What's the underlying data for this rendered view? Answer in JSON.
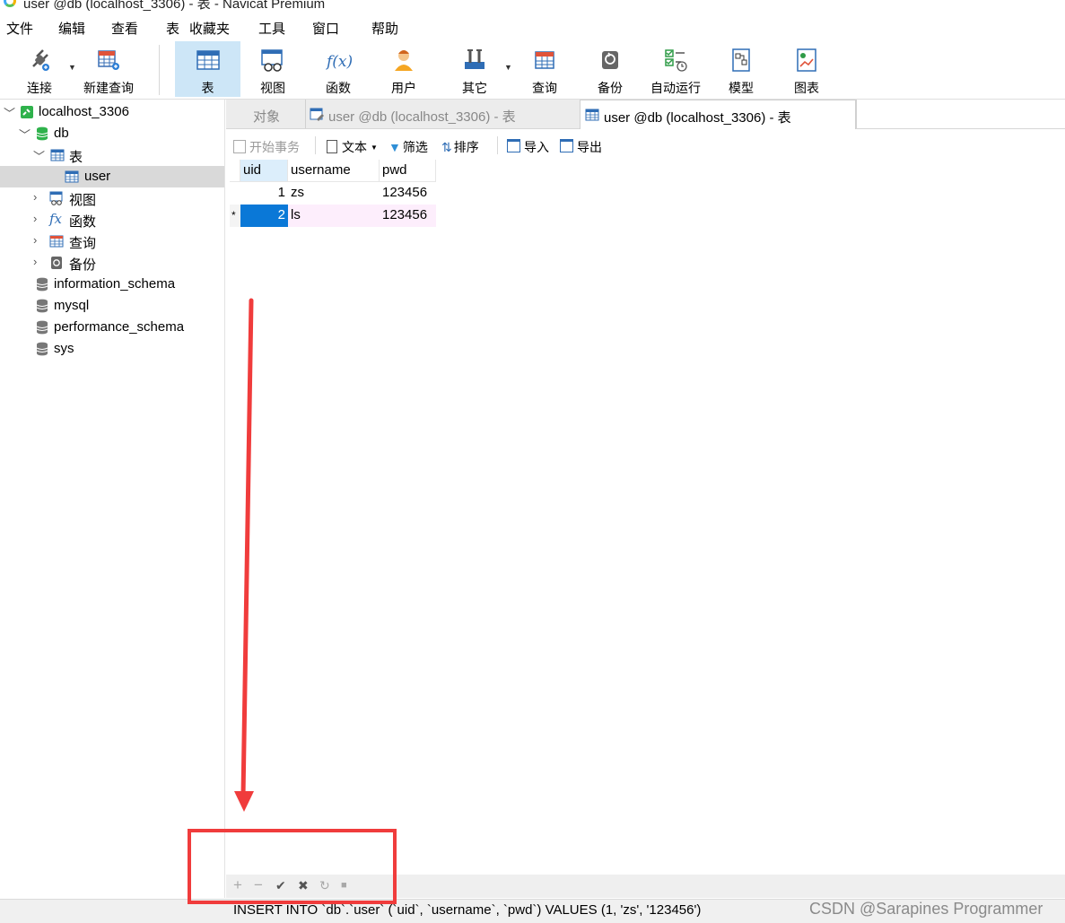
{
  "window": {
    "title": "user @db (localhost_3306) - 表 - Navicat Premium"
  },
  "menu": [
    "文件",
    "编辑",
    "查看",
    "表",
    "收藏夹",
    "工具",
    "窗口",
    "帮助"
  ],
  "toolbar": {
    "items": [
      {
        "label": "连接",
        "icon": "plug-icon"
      },
      {
        "label": "新建查询",
        "icon": "new-query-icon"
      },
      {
        "label": "表",
        "icon": "table-icon"
      },
      {
        "label": "视图",
        "icon": "view-icon"
      },
      {
        "label": "函数",
        "icon": "function-icon"
      },
      {
        "label": "用户",
        "icon": "user-icon"
      },
      {
        "label": "其它",
        "icon": "tools-icon"
      },
      {
        "label": "查询",
        "icon": "query-icon"
      },
      {
        "label": "备份",
        "icon": "backup-icon"
      },
      {
        "label": "自动运行",
        "icon": "schedule-icon"
      },
      {
        "label": "模型",
        "icon": "model-icon"
      },
      {
        "label": "图表",
        "icon": "chart-icon"
      }
    ],
    "function_glyph": "f(x)"
  },
  "sidebar": {
    "connection": "localhost_3306",
    "database": "db",
    "tables_group": "表",
    "table": "user",
    "views": "视图",
    "functions": "函数",
    "queries": "查询",
    "backups": "备份",
    "fx_glyph": "fx",
    "other_dbs": [
      "information_schema",
      "mysql",
      "performance_schema",
      "sys"
    ]
  },
  "tabs": {
    "objects": "对象",
    "tab1": "user @db (localhost_3306) - 表",
    "tab2": "user @db (localhost_3306) - 表"
  },
  "subtoolbar": {
    "begin_tx": "开始事务",
    "text": "文本",
    "filter": "筛选",
    "sort": "排序",
    "import": "导入",
    "export": "导出"
  },
  "grid": {
    "columns": [
      "uid",
      "username",
      "pwd"
    ],
    "rows": [
      {
        "marker": "",
        "uid": "1",
        "username": "zs",
        "pwd": "123456"
      },
      {
        "marker": "*",
        "uid": "2",
        "username": "ls",
        "pwd": "123456"
      }
    ]
  },
  "record_bar": {
    "add": "+",
    "delete": "−",
    "apply": "✔",
    "discard": "✖",
    "refresh": "↻",
    "stop": "■"
  },
  "status": {
    "sql": "INSERT INTO `db`.`user` (`uid`, `username`, `pwd`) VALUES (1, 'zs', '123456')",
    "watermark": "CSDN @Sarapines Programmer"
  },
  "colors": {
    "annotation_red": "#f03c3c",
    "selection_blue": "#0a78d7",
    "active_tool": "#cde6f7"
  }
}
